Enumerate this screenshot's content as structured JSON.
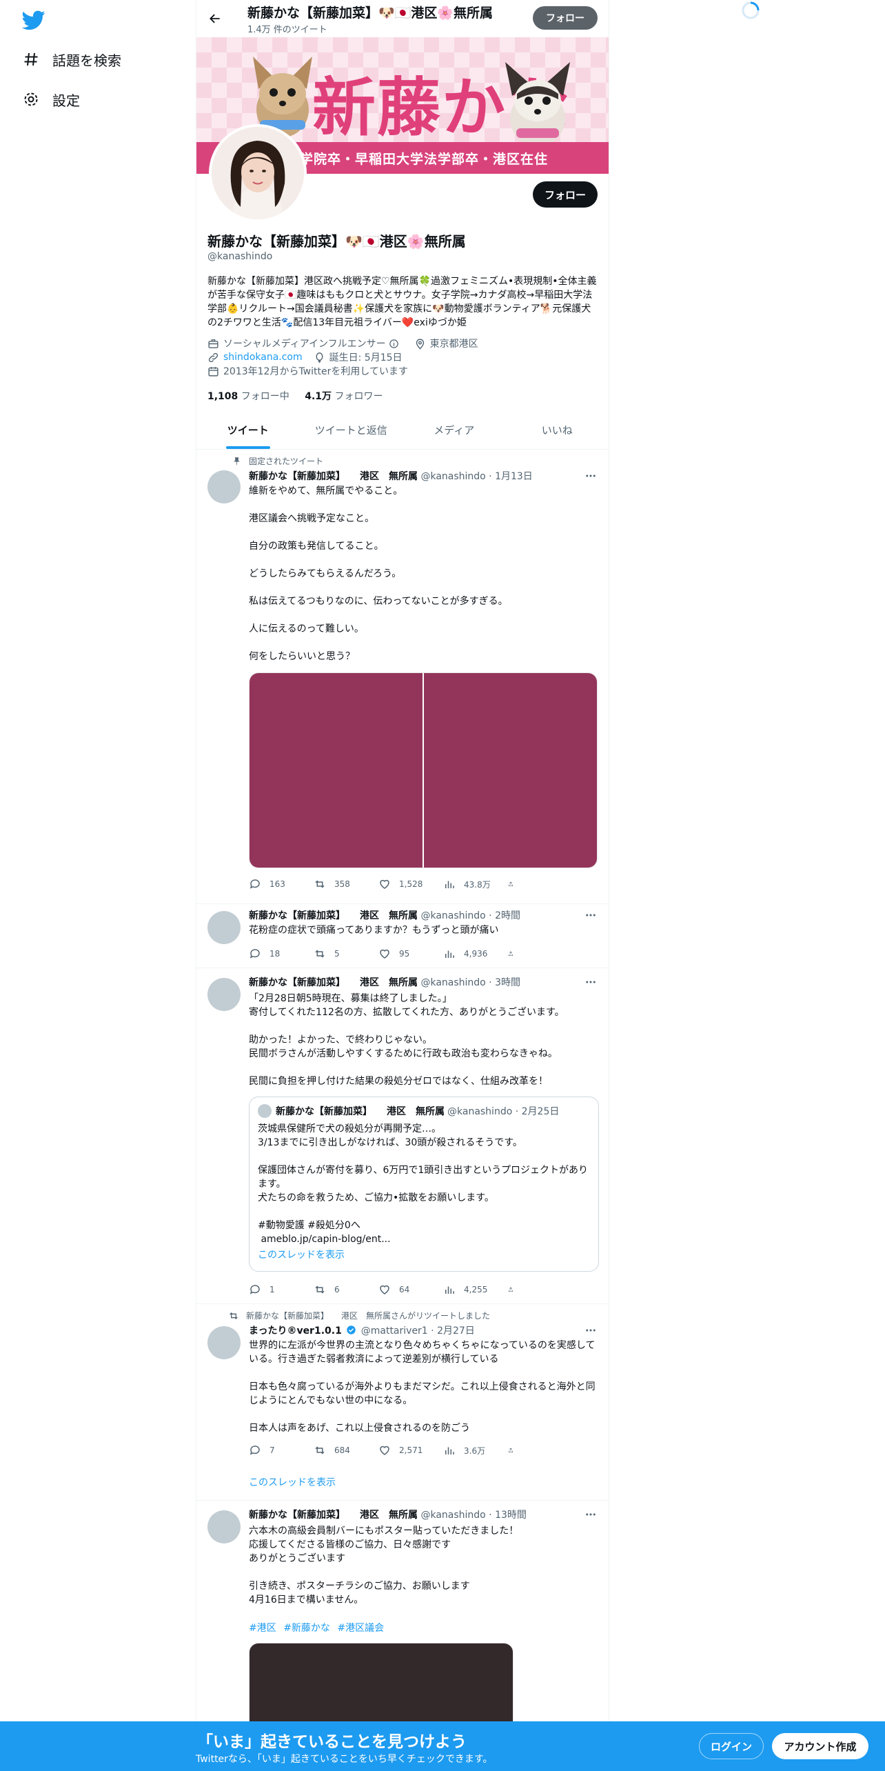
{
  "nav": {
    "explore_label": "話題を検索",
    "settings_label": "設定"
  },
  "header": {
    "title": "新藤かな【新藤加菜】🐶🇯🇵港区🌸無所属",
    "tweet_count": "1.4万 件のツイート",
    "follow_label": "フォロー"
  },
  "banner": {
    "name": "新藤かな",
    "strip_text": "学院卒・早稲田大学法学部卒・港区在住"
  },
  "profile": {
    "name": "新藤かな【新藤加菜】🐶🇯🇵港区🌸無所属",
    "handle": "@kanashindo",
    "follow_label": "フォロー",
    "bio": "新藤かな【新藤加菜】港区政へ挑戦予定♡無所属🍀過激フェミニズム•表現規制•全体主義が苦手な保守女子🇯🇵趣味はももクロと犬とサウナ。女子学院→カナダ高校→早稲田大学法学部👶リクルート→国会議員秘書✨保護犬を家族に🐶動物愛護ボランティア🐕元保護犬の2チワワと生活🐾配信13年目元祖ライバー❤️exiゆづか姫",
    "category": "ソーシャルメディアインフルエンサー",
    "location": "東京都港区",
    "website": "shindokana.com",
    "birthday": "誕生日: 5月15日",
    "joined": "2013年12月からTwitterを利用しています",
    "following_count": "1,108",
    "following_label": "フォロー中",
    "followers_count": "4.1万",
    "followers_label": "フォロワー"
  },
  "tabs": [
    "ツイート",
    "ツイートと返信",
    "メディア",
    "いいね"
  ],
  "tweets": [
    {
      "context": "固定されたツイート",
      "name": "新藤かな【新藤加菜】　　港区　無所属",
      "meta": "@kanashindo · 1月13日",
      "text": "維新をやめて、無所属でやること。\n\n港区議会へ挑戦予定なこと。\n\n自分の政策も発信してること。\n\nどうしたらみてもらえるんだろう。\n\n私は伝えてるつもりなのに、伝わってないことが多すぎる。\n\n人に伝えるのって難しい。\n\n何をしたらいいと思う？",
      "reply": "163",
      "retweet": "358",
      "like": "1,528",
      "views": "43.8万"
    },
    {
      "name": "新藤かな【新藤加菜】　　港区　無所属",
      "meta": "@kanashindo · 2時間",
      "text": "花粉症の症状で頭痛ってありますか？もうずっと頭が痛い",
      "reply": "18",
      "retweet": "5",
      "like": "95",
      "views": "4,936"
    },
    {
      "name": "新藤かな【新藤加菜】　　港区　無所属",
      "meta": "@kanashindo · 3時間",
      "text": "「2月28日朝5時現在、募集は終了しました。」\n寄付してくれた112名の方、拡散してくれた方、ありがとうございます。\n\n助かった！よかった、で終わりじゃない。\n民間ボラさんが活動しやすくするために行政も政治も変わらなきゃね。\n\n民間に負担を押し付けた結果の殺処分ゼロではなく、仕組み改革を！",
      "quote_name": "新藤かな【新藤加菜】　　港区　無所属",
      "quote_meta": "@kanashindo · 2月25日",
      "quote_text": "茨城県保健所で犬の殺処分が再開予定…。\n3/13までに引き出しがなければ、30頭が殺されるそうです。\n\n保護団体さんが寄付を募り、6万円で1頭引き出すというプロジェクトがあります。\n犬たちの命を救うため、ご協力•拡散をお願いします。\n\n#動物愛護 #殺処分0へ\n ameblo.jp/capin-blog/ent...",
      "quote_thread": "このスレッドを表示",
      "reply": "1",
      "retweet": "6",
      "like": "64",
      "views": "4,255"
    },
    {
      "context": "新藤かな【新藤加菜】　　港区　無所属さんがリツイートしました",
      "name": "まったり®ver1.0.1",
      "meta": "@mattariver1 · 2月27日",
      "text": "世界的に左派が今世界の主流となり色々めちゃくちゃになっているのを実感している。行き過ぎた弱者救済によって逆差別が横行している\n\n日本も色々腐っているが海外よりもまだマシだ。これ以上侵食されると海外と同じようにとんでもない世の中になる。\n\n日本人は声をあげ、これ以上侵食されるのを防ごう",
      "thread": "このスレッドを表示",
      "reply": "7",
      "retweet": "684",
      "like": "2,571",
      "views": "3.6万"
    },
    {
      "name": "新藤かな【新藤加菜】　　港区　無所属",
      "meta": "@kanashindo · 13時間",
      "text": "六本木の高級会員制バーにもポスター貼っていただきました！\n応援してくださる皆様のご協力、日々感謝です\nありがとうございます\n\n引き続き、ポスターチラシのご協力、お願いします\n4月16日まで構いません。",
      "hashtags": [
        "#港区",
        "#新藤かな",
        "#港区議会"
      ]
    }
  ],
  "bottom": {
    "title": "「いま」起きていることを見つけよう",
    "subtitle": "Twitterなら、「いま」起きていることをいち早くチェックできます。",
    "login": "ログイン",
    "signup": "アカウント作成"
  },
  "colors": {
    "accent": "#1d9bf0",
    "media_purple": "#93345b",
    "media_dark": "#33282a",
    "banner_pink": "#e0407a"
  }
}
